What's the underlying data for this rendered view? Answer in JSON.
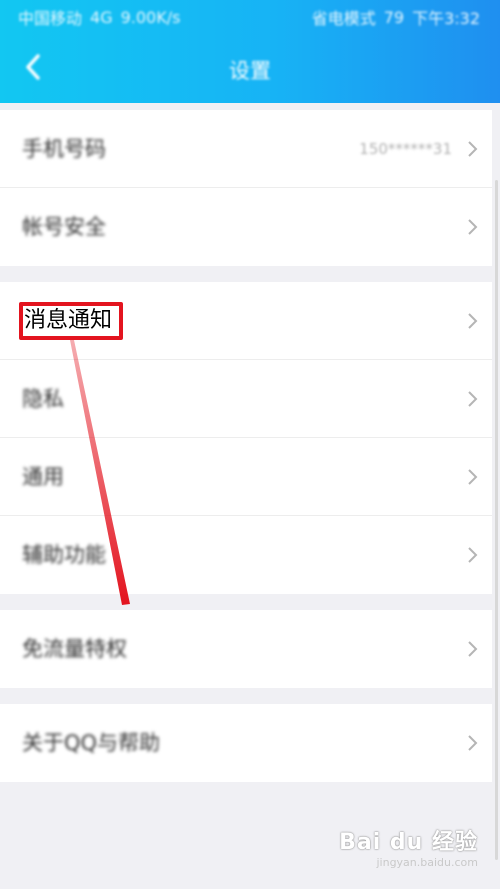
{
  "status_bar": {
    "carrier": "中国移动",
    "network": "4G",
    "speed": "9.00K/s",
    "right_text": "省电模式",
    "battery": "79",
    "time": "下午3:32"
  },
  "header": {
    "title": "设置"
  },
  "groups": [
    {
      "rows": [
        {
          "label": "手机号码",
          "value": "150******31"
        },
        {
          "label": "帐号安全",
          "value": ""
        }
      ]
    },
    {
      "rows": [
        {
          "label": "消息通知",
          "value": ""
        },
        {
          "label": "隐私",
          "value": ""
        },
        {
          "label": "通用",
          "value": ""
        },
        {
          "label": "辅助功能",
          "value": ""
        }
      ]
    },
    {
      "rows": [
        {
          "label": "免流量特权",
          "value": ""
        }
      ]
    },
    {
      "rows": [
        {
          "label": "关于QQ与帮助",
          "value": ""
        }
      ]
    }
  ],
  "annotation_color": "#e3141f",
  "accent_color": "#17b3f5",
  "watermark": {
    "brand": "Bai du 经验",
    "url": "jingyan.baidu.com"
  }
}
